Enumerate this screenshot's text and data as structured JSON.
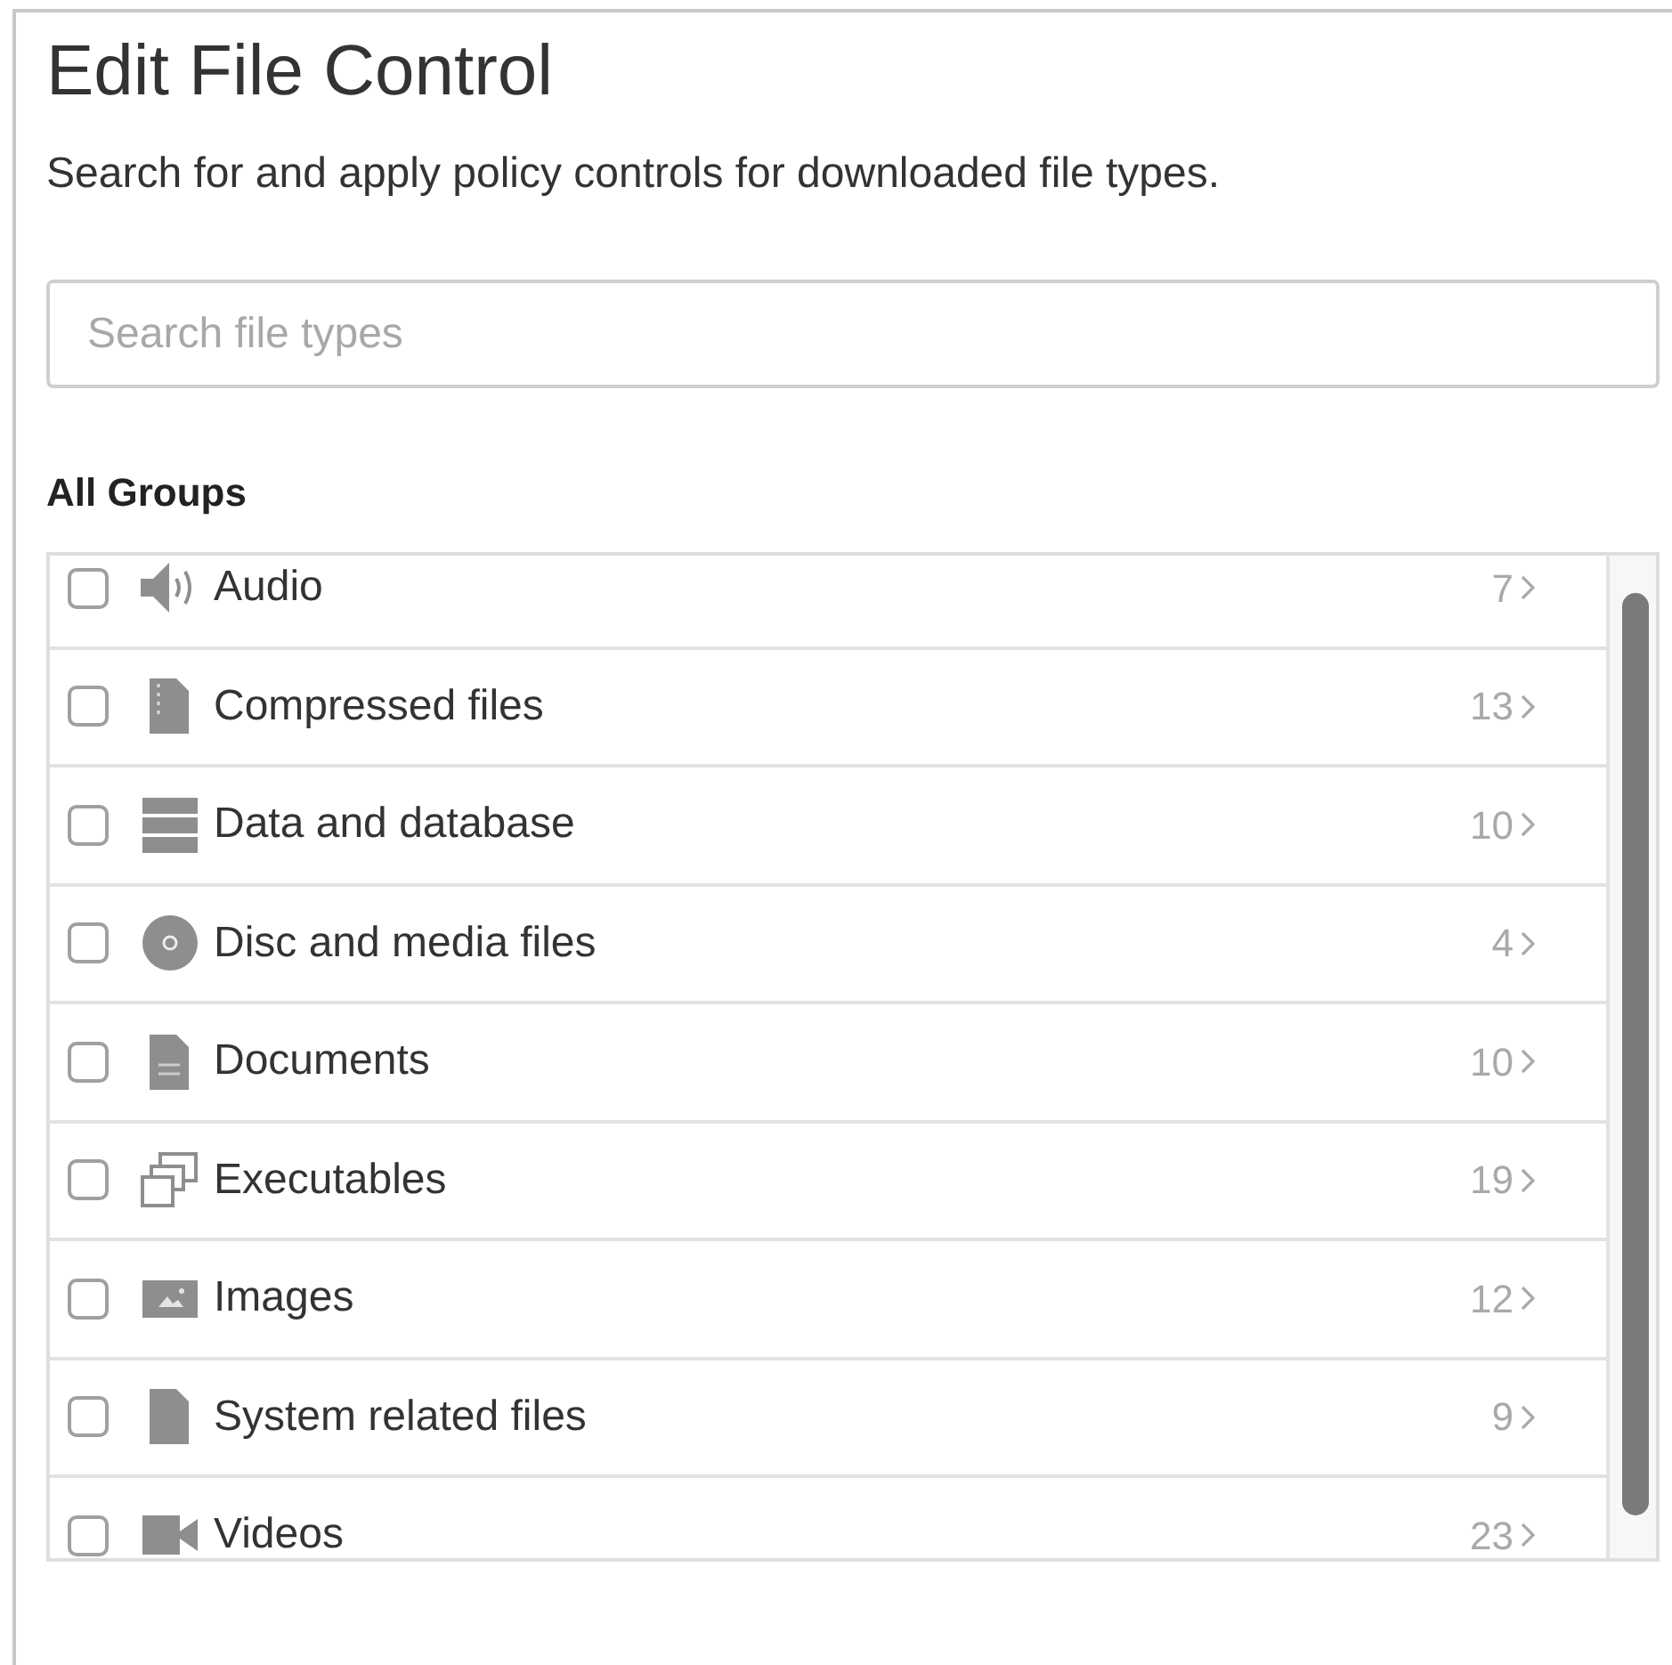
{
  "title": "Edit File Control",
  "description": "Search for and apply policy controls for downloaded file types.",
  "search": {
    "placeholder": "Search file types"
  },
  "groups_heading": "All Groups",
  "groups": [
    {
      "kind": "audio",
      "label": "Audio",
      "count": "7",
      "checked": false
    },
    {
      "kind": "compressed",
      "label": "Compressed files",
      "count": "13",
      "checked": false
    },
    {
      "kind": "data",
      "label": "Data and database",
      "count": "10",
      "checked": false
    },
    {
      "kind": "disc",
      "label": "Disc and media files",
      "count": "4",
      "checked": false
    },
    {
      "kind": "document",
      "label": "Documents",
      "count": "10",
      "checked": false
    },
    {
      "kind": "executable",
      "label": "Executables",
      "count": "19",
      "checked": false
    },
    {
      "kind": "image",
      "label": "Images",
      "count": "12",
      "checked": false
    },
    {
      "kind": "system",
      "label": "System related files",
      "count": "9",
      "checked": false
    },
    {
      "kind": "video",
      "label": "Videos",
      "count": "23",
      "checked": false
    }
  ]
}
